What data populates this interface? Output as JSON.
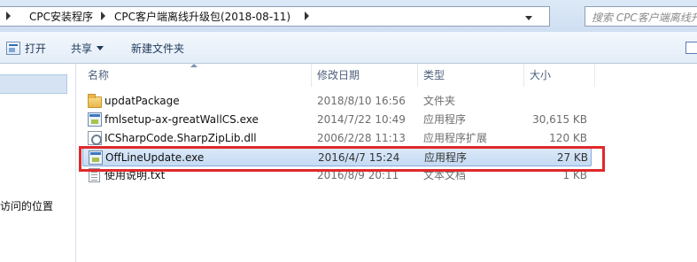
{
  "address": {
    "crumbs": [
      "CPC安装程序",
      "CPC客户端离线升级包(2018-08-11)"
    ],
    "search_placeholder": "搜索 CPC客户端离线升"
  },
  "toolbar": {
    "open_label": "打开",
    "share_label": "共享",
    "new_folder_label": "新建文件夹"
  },
  "navpane": {
    "partial_item": "访问的位置"
  },
  "columns": {
    "name": "名称",
    "date": "修改日期",
    "type": "类型",
    "size": "大小"
  },
  "files": [
    {
      "name": "updatPackage",
      "date": "2018/8/10 16:56",
      "type": "文件夹",
      "size": "",
      "icon": "folder-icon"
    },
    {
      "name": "fmlsetup-ax-greatWallCS.exe",
      "date": "2014/7/22 10:49",
      "type": "应用程序",
      "size": "30,615 KB",
      "icon": "exe-icon"
    },
    {
      "name": "ICSharpCode.SharpZipLib.dll",
      "date": "2006/2/28 11:13",
      "type": "应用程序扩展",
      "size": "120 KB",
      "icon": "dll-icon"
    },
    {
      "name": "OffLineUpdate.exe",
      "date": "2016/4/7 15:24",
      "type": "应用程序",
      "size": "27 KB",
      "icon": "exe-icon",
      "selected": true
    },
    {
      "name": "使用说明.txt",
      "date": "2016/8/9 20:11",
      "type": "文本文档",
      "size": "1 KB",
      "icon": "txt-icon"
    }
  ],
  "annotation": {
    "highlight_color": "#e0292b",
    "highlighted_item": "OffLineUpdate.exe"
  }
}
